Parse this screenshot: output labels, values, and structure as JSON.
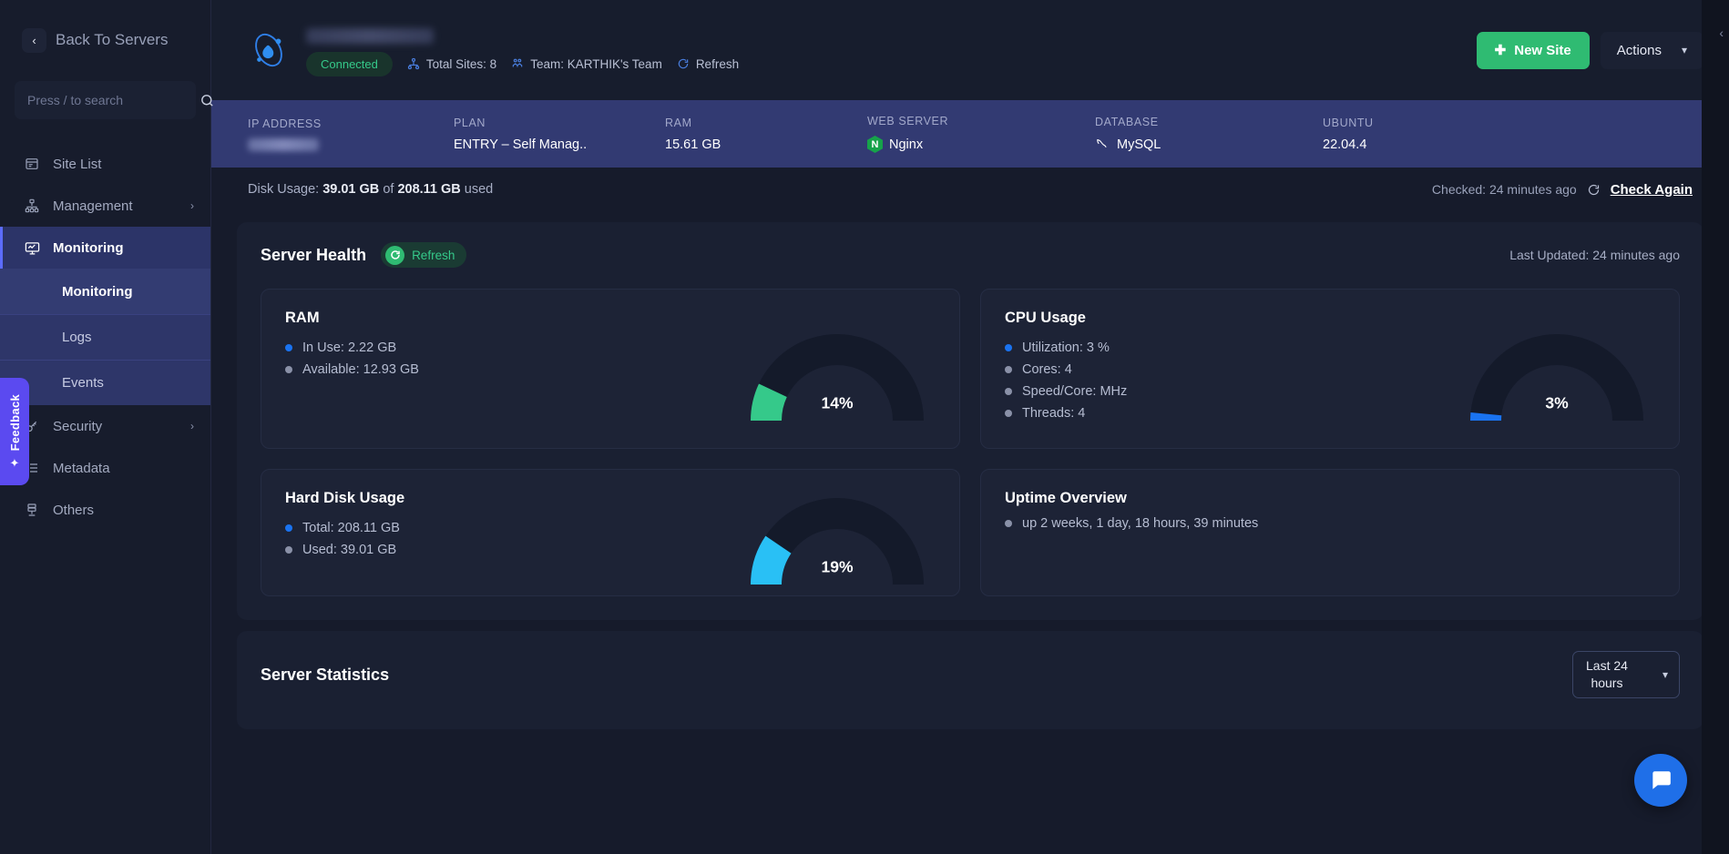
{
  "feedback": {
    "label": "Feedback",
    "icon": "sparkles-icon"
  },
  "sidebar": {
    "back_label": "Back To Servers",
    "search_placeholder": "Press / to search",
    "search_value": "",
    "items": [
      {
        "label": "Site List",
        "icon": "window-icon",
        "has_chevron": false
      },
      {
        "label": "Management",
        "icon": "sitemap-icon",
        "has_chevron": true
      },
      {
        "label": "Monitoring",
        "icon": "monitor-icon",
        "has_chevron": false,
        "active": true
      },
      {
        "label": "Security",
        "icon": "key-icon",
        "has_chevron": true
      },
      {
        "label": "Metadata",
        "icon": "list-icon",
        "has_chevron": false
      },
      {
        "label": "Others",
        "icon": "server-icon",
        "has_chevron": false
      }
    ],
    "submenu": [
      {
        "label": "Monitoring",
        "active": true
      },
      {
        "label": "Logs",
        "active": false
      },
      {
        "label": "Events",
        "active": false
      }
    ]
  },
  "header": {
    "logo": "cloud-orbit-icon",
    "server_name_redacted": true,
    "status_badge": "Connected",
    "total_sites": "Total Sites: 8",
    "team": "Team: KARTHIK's Team",
    "refresh": "Refresh",
    "new_site_button": "New Site",
    "actions_button": "Actions"
  },
  "info_strip": [
    {
      "label": "IP ADDRESS",
      "value": "",
      "redacted": true
    },
    {
      "label": "PLAN",
      "value": "ENTRY – Self Manag.."
    },
    {
      "label": "RAM",
      "value": "15.61 GB"
    },
    {
      "label": "WEB SERVER",
      "value": "Nginx",
      "icon": "nginx-icon"
    },
    {
      "label": "DATABASE",
      "value": "MySQL",
      "icon": "mysql-dolphin-icon"
    },
    {
      "label": "UBUNTU",
      "value": "22.04.4"
    }
  ],
  "disk_row": {
    "prefix": "Disk Usage:",
    "used": "39.01 GB",
    "middle": "of",
    "total": "208.11 GB",
    "suffix": "used",
    "checked": "Checked: 24 minutes ago",
    "check_again": "Check Again"
  },
  "server_health": {
    "title": "Server Health",
    "refresh_label": "Refresh",
    "last_updated": "Last Updated: 24 minutes ago",
    "cards": [
      {
        "title": "RAM",
        "percent_label": "14%",
        "percent": 14,
        "color": "#35c98a",
        "items": [
          {
            "text": "In Use: 2.22 GB",
            "dot": "#1a73f0"
          },
          {
            "text": "Available: 12.93 GB",
            "dot": "#8a91a8"
          }
        ]
      },
      {
        "title": "CPU Usage",
        "percent_label": "3%",
        "percent": 3,
        "color": "#1a73f0",
        "items": [
          {
            "text": "Utilization: 3 %",
            "dot": "#1a73f0"
          },
          {
            "text": "Cores: 4",
            "dot": "#8a91a8"
          },
          {
            "text": "Speed/Core: MHz",
            "dot": "#8a91a8"
          },
          {
            "text": "Threads: 4",
            "dot": "#8a91a8"
          }
        ]
      },
      {
        "title": "Hard Disk Usage",
        "percent_label": "19%",
        "percent": 19,
        "color": "#29c0f5",
        "items": [
          {
            "text": "Total: 208.11 GB",
            "dot": "#1a73f0"
          },
          {
            "text": "Used: 39.01 GB",
            "dot": "#8a91a8"
          }
        ]
      },
      {
        "title": "Uptime Overview",
        "percent_label": "",
        "percent": null,
        "color": "",
        "items": [
          {
            "text": "up 2 weeks, 1 day, 18 hours, 39 minutes",
            "dot": "#8a91a8"
          }
        ]
      }
    ]
  },
  "server_statistics": {
    "title": "Server Statistics",
    "range_line1": "Last 24",
    "range_line2": "hours"
  },
  "chart_data": {
    "type": "pie",
    "title": "Server Health Gauges",
    "series": [
      {
        "name": "RAM",
        "value": 14,
        "unit": "%",
        "color": "#35c98a"
      },
      {
        "name": "CPU Usage",
        "value": 3,
        "unit": "%",
        "color": "#1a73f0"
      },
      {
        "name": "Hard Disk Usage",
        "value": 19,
        "unit": "%",
        "color": "#29c0f5"
      }
    ],
    "ylim": [
      0,
      100
    ],
    "legend": "none"
  }
}
